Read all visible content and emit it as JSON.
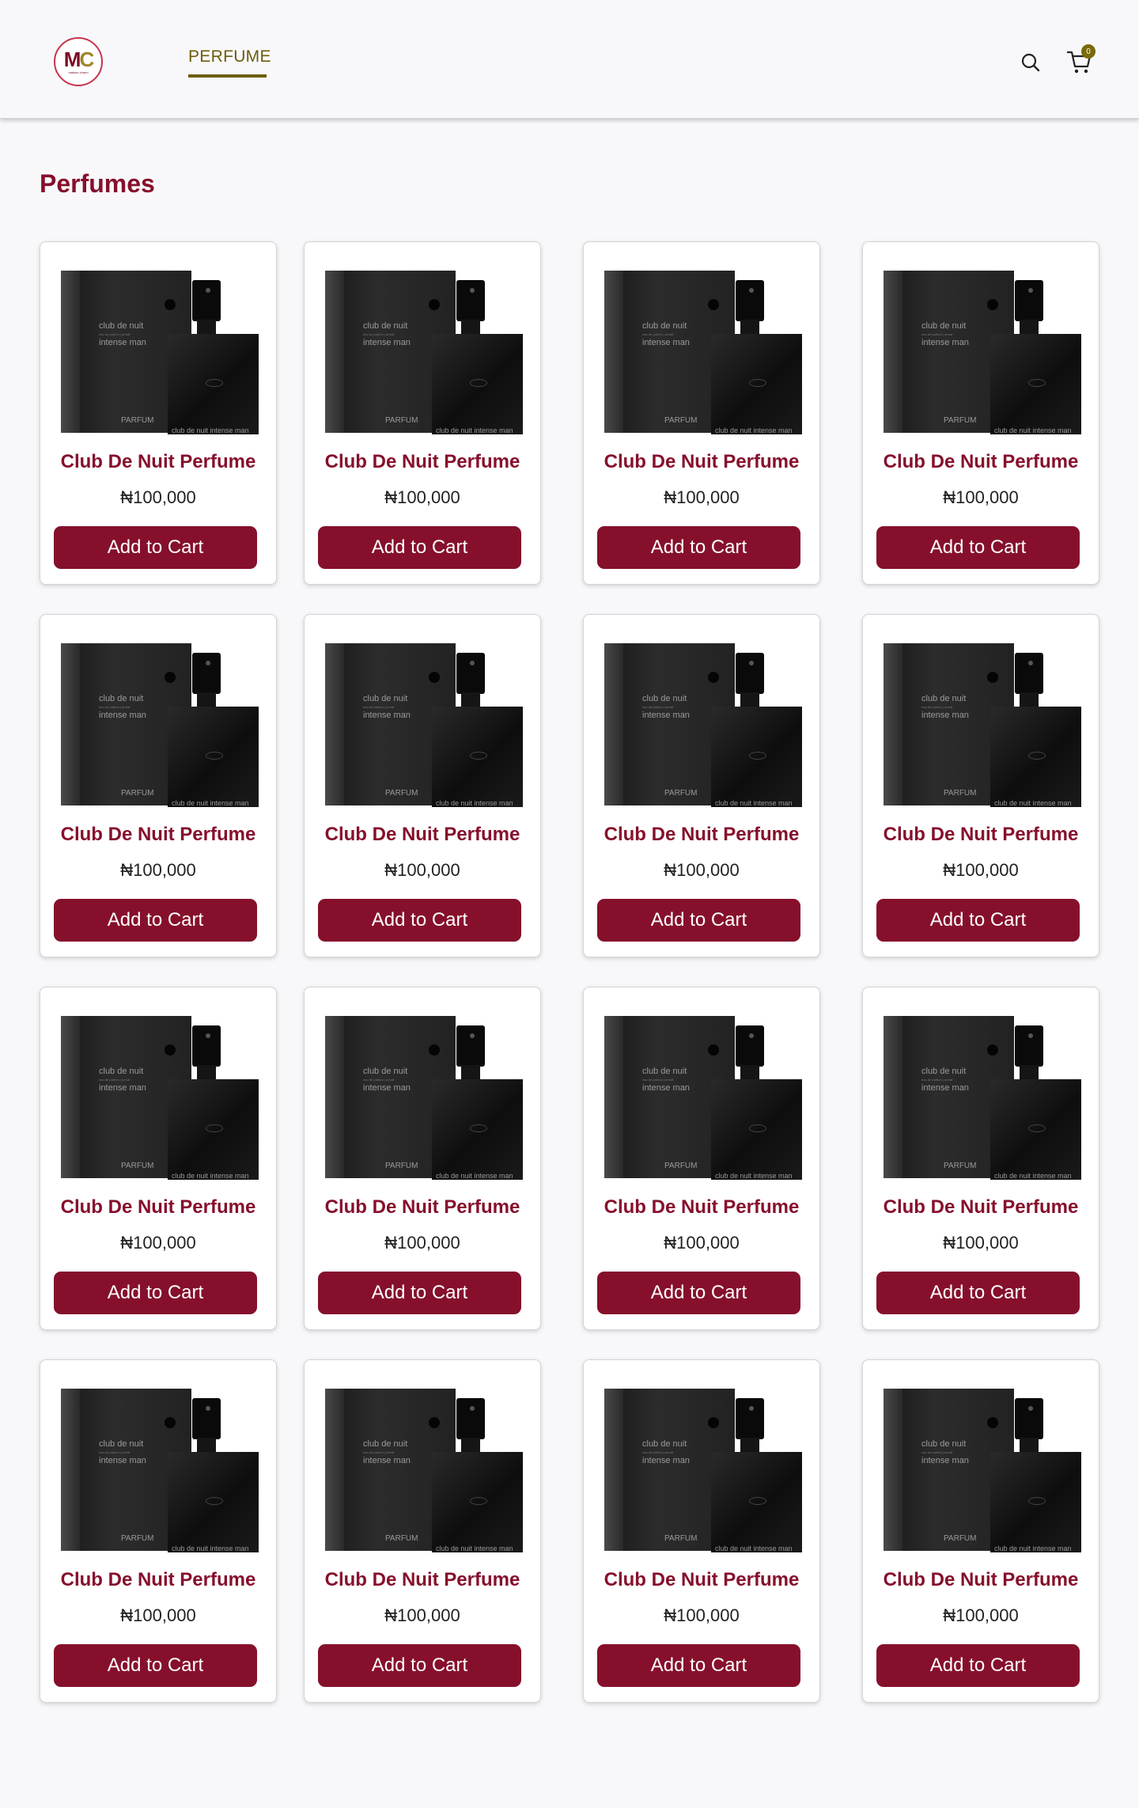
{
  "header": {
    "logo_text": "MC",
    "logo_subtitle": "maison charm",
    "nav": [
      {
        "label": "PERFUME",
        "active": true
      }
    ],
    "cart_count": "0"
  },
  "page": {
    "title": "Perfumes"
  },
  "product_art": {
    "box_brand": "club de nuit",
    "box_small": "eau de parfum | armaf",
    "box_variant": "intense man",
    "box_bottom": "PARFUM",
    "bottle_label": "club de nuit intense man"
  },
  "products": [
    {
      "name": "Club De Nuit Perfume",
      "price": "₦100,000",
      "button": "Add to Cart"
    },
    {
      "name": "Club De Nuit Perfume",
      "price": "₦100,000",
      "button": "Add to Cart"
    },
    {
      "name": "Club De Nuit Perfume",
      "price": "₦100,000",
      "button": "Add to Cart"
    },
    {
      "name": "Club De Nuit Perfume",
      "price": "₦100,000",
      "button": "Add to Cart"
    },
    {
      "name": "Club De Nuit Perfume",
      "price": "₦100,000",
      "button": "Add to Cart"
    },
    {
      "name": "Club De Nuit Perfume",
      "price": "₦100,000",
      "button": "Add to Cart"
    },
    {
      "name": "Club De Nuit Perfume",
      "price": "₦100,000",
      "button": "Add to Cart"
    },
    {
      "name": "Club De Nuit Perfume",
      "price": "₦100,000",
      "button": "Add to Cart"
    },
    {
      "name": "Club De Nuit Perfume",
      "price": "₦100,000",
      "button": "Add to Cart"
    },
    {
      "name": "Club De Nuit Perfume",
      "price": "₦100,000",
      "button": "Add to Cart"
    },
    {
      "name": "Club De Nuit Perfume",
      "price": "₦100,000",
      "button": "Add to Cart"
    },
    {
      "name": "Club De Nuit Perfume",
      "price": "₦100,000",
      "button": "Add to Cart"
    },
    {
      "name": "Club De Nuit Perfume",
      "price": "₦100,000",
      "button": "Add to Cart"
    },
    {
      "name": "Club De Nuit Perfume",
      "price": "₦100,000",
      "button": "Add to Cart"
    },
    {
      "name": "Club De Nuit Perfume",
      "price": "₦100,000",
      "button": "Add to Cart"
    },
    {
      "name": "Club De Nuit Perfume",
      "price": "₦100,000",
      "button": "Add to Cart"
    }
  ],
  "colors": {
    "brand": "#86102c",
    "nav_accent": "#6b5d0a",
    "background": "#f8f8fa"
  },
  "icons": [
    "search-icon",
    "cart-icon",
    "logo"
  ]
}
